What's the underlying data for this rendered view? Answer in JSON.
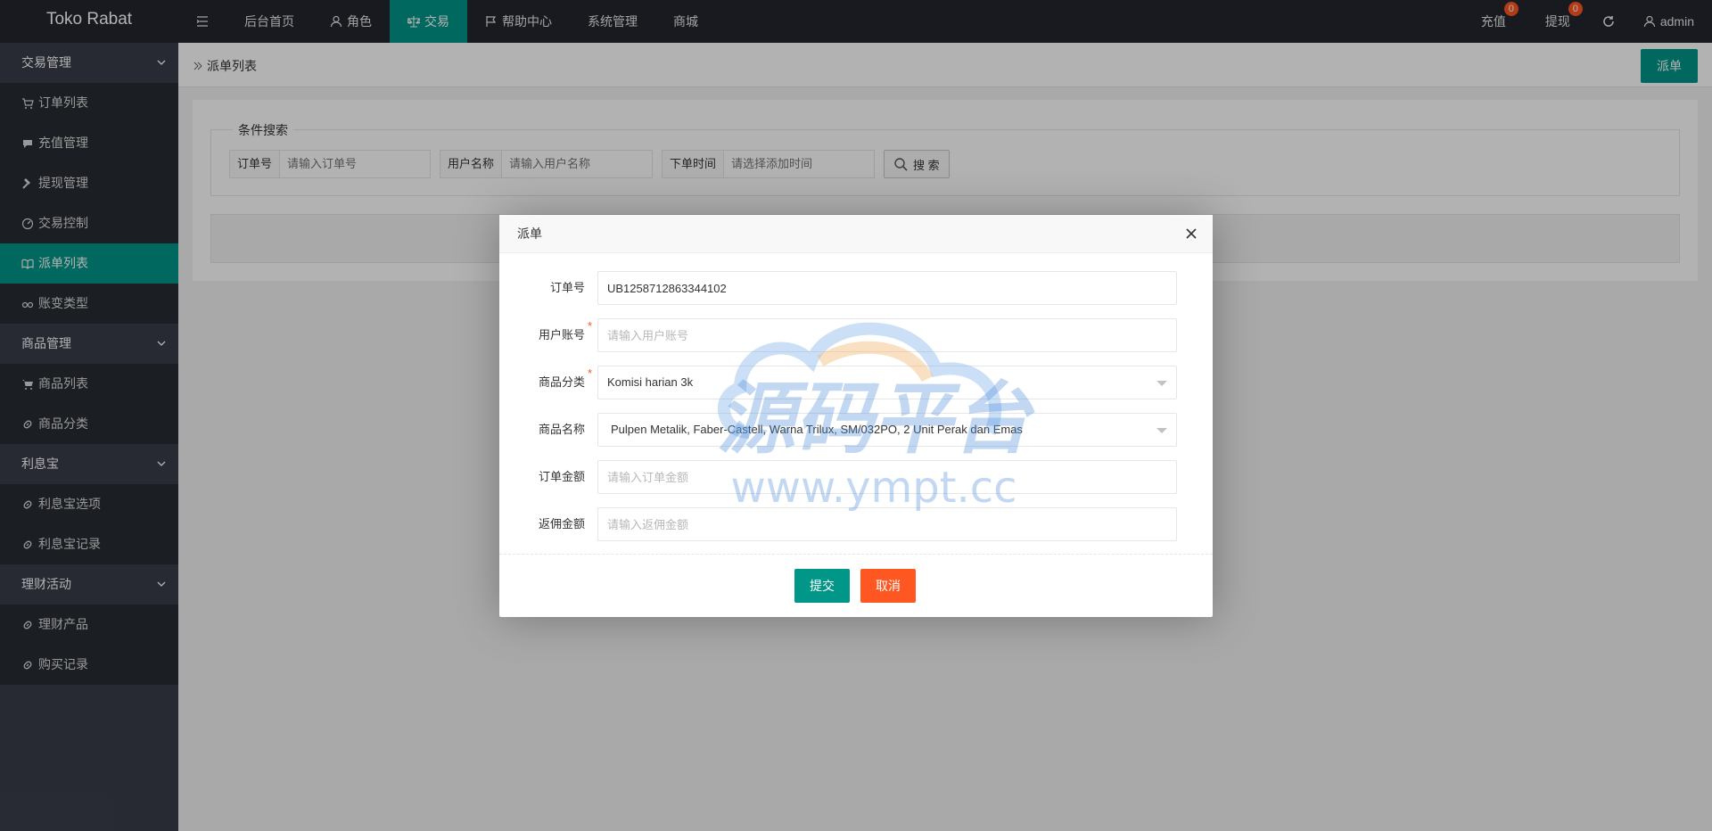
{
  "app": {
    "title": "Toko Rabat"
  },
  "topnav": {
    "items": [
      {
        "label": "",
        "icon": "menu-toggle-icon"
      },
      {
        "label": "后台首页"
      },
      {
        "label": "角色",
        "icon": "user-icon"
      },
      {
        "label": "交易",
        "icon": "scale-icon",
        "active": true
      },
      {
        "label": "帮助中心",
        "icon": "flag-icon"
      },
      {
        "label": "系统管理"
      },
      {
        "label": "商城"
      }
    ],
    "right": {
      "recharge": {
        "label": "充值",
        "badge": "0"
      },
      "withdraw": {
        "label": "提现",
        "badge": "0"
      },
      "refresh_icon": "refresh-icon",
      "user": "admin"
    }
  },
  "sidebar": {
    "groups": [
      {
        "label": "交易管理",
        "items": [
          {
            "label": "订单列表",
            "icon": "cart-icon"
          },
          {
            "label": "充值管理",
            "icon": "comment-icon"
          },
          {
            "label": "提现管理",
            "icon": "hammer-icon"
          },
          {
            "label": "交易控制",
            "icon": "dashboard-icon"
          },
          {
            "label": "派单列表",
            "icon": "book-icon",
            "active": true
          },
          {
            "label": "账变类型",
            "icon": "link-icon"
          }
        ]
      },
      {
        "label": "商品管理",
        "items": [
          {
            "label": "商品列表",
            "icon": "cart-icon"
          },
          {
            "label": "商品分类",
            "icon": "link-icon"
          }
        ]
      },
      {
        "label": "利息宝",
        "items": [
          {
            "label": "利息宝选项",
            "icon": "link-icon"
          },
          {
            "label": "利息宝记录",
            "icon": "link-icon"
          }
        ]
      },
      {
        "label": "理财活动",
        "items": [
          {
            "label": "理财产品",
            "icon": "link-icon"
          },
          {
            "label": "购买记录",
            "icon": "link-icon"
          }
        ]
      }
    ]
  },
  "page": {
    "breadcrumb": "派单列表",
    "dispatch_button": "派单",
    "search": {
      "legend": "条件搜索",
      "fields": [
        {
          "label": "订单号",
          "placeholder": "请输入订单号"
        },
        {
          "label": "用户名称",
          "placeholder": "请输入用户名称"
        },
        {
          "label": "下单时间",
          "placeholder": "请选择添加时间"
        }
      ],
      "button": "搜 索"
    }
  },
  "modal": {
    "title": "派单",
    "fields": {
      "order_no": {
        "label": "订单号",
        "value": "UB1258712863344102"
      },
      "user_account": {
        "label": "用户账号",
        "placeholder": "请输入用户账号",
        "required": "*"
      },
      "category": {
        "label": "商品分类",
        "value": "Komisi harian 3k",
        "required": "*"
      },
      "product_name": {
        "label": "商品名称",
        "value": "Pulpen Metalik, Faber-Castell, Warna Trilux, SM/032PO, 2 Unit Perak dan Emas"
      },
      "order_amount": {
        "label": "订单金额",
        "placeholder": "请输入订单金额"
      },
      "rebate_amount": {
        "label": "返佣金额",
        "placeholder": "请输入返佣金额"
      }
    },
    "submit": "提交",
    "cancel": "取消"
  },
  "watermark": {
    "text_cn": "源码平台",
    "text_url": "www.ympt.cc"
  },
  "colors": {
    "accent": "#009688",
    "danger": "#ff5722",
    "header": "#23262e",
    "sidebar": "#393d49"
  }
}
